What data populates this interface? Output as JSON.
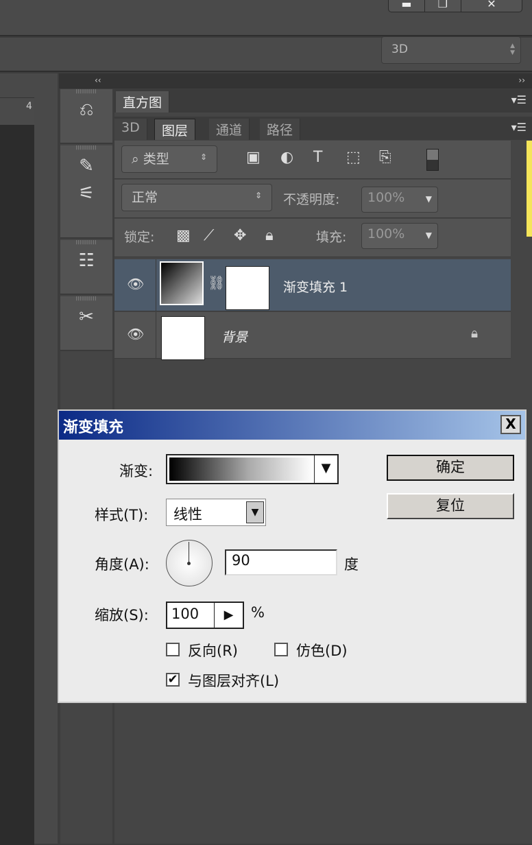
{
  "window": {
    "buttons": [
      "▬",
      "❐",
      "✕"
    ]
  },
  "options": {
    "workspace": "3D"
  },
  "ruler": {
    "mark": "4"
  },
  "collapse": {
    "left": "‹‹",
    "right": "››"
  },
  "panel": {
    "top_tab": "直方图",
    "tabs": [
      "3D",
      "图层",
      "通道",
      "路径"
    ],
    "filter": {
      "value": "类型"
    },
    "blend": {
      "mode": "正常",
      "opacity_label": "不透明度:",
      "opacity": "100%"
    },
    "lock": {
      "label": "锁定:",
      "fill_label": "填充:",
      "fill": "100%"
    },
    "layers": [
      {
        "name": "渐变填充 1",
        "selected": true
      },
      {
        "name": "背景",
        "locked": true
      }
    ]
  },
  "dialog": {
    "title": "渐变填充",
    "close": "X",
    "gradient_label": "渐变:",
    "style_label": "样式(T):",
    "style_value": "线性",
    "angle_label": "角度(A):",
    "angle_value": "90",
    "angle_unit": "度",
    "scale_label": "缩放(S):",
    "scale_value": "100",
    "scale_unit": "%",
    "reverse": {
      "label": "反向(R)",
      "checked": false
    },
    "dither": {
      "label": "仿色(D)",
      "checked": false
    },
    "align": {
      "label": "与图层对齐(L)",
      "checked": true
    },
    "ok": "确定",
    "reset": "复位"
  }
}
